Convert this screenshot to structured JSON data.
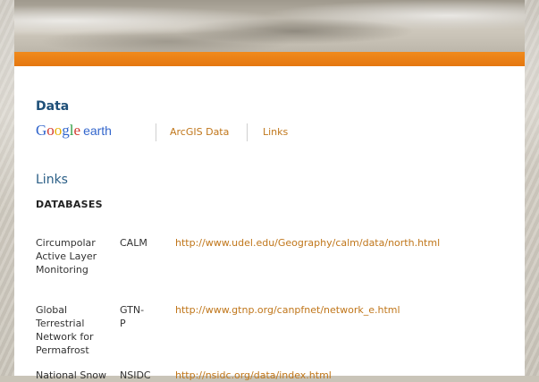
{
  "section_title": "Data",
  "tabs": {
    "google_earth_logo": "Google earth",
    "arcgis_label": "ArcGIS Data",
    "links_label": "Links"
  },
  "links_heading": "Links",
  "databases_heading": "DATABASES",
  "databases": [
    {
      "name_lines": [
        "Circumpolar",
        "Active Layer",
        "Monitoring"
      ],
      "abbr": "CALM",
      "url": "http://www.udel.edu/Geography/calm/data/north.html"
    },
    {
      "name_lines": [
        "Global Terrestrial",
        "Network for",
        "Permafrost"
      ],
      "abbr": "GTN-P",
      "url": "http://www.gtnp.org/canpfnet/network_e.html"
    },
    {
      "name_lines": [
        "National Snow"
      ],
      "abbr": "NSIDC",
      "url": "http://nsidc.org/data/index.html"
    }
  ],
  "colors": {
    "accent_orange": "#e57710",
    "link_orange": "#c0761a",
    "heading_blue": "#1e4f78"
  }
}
